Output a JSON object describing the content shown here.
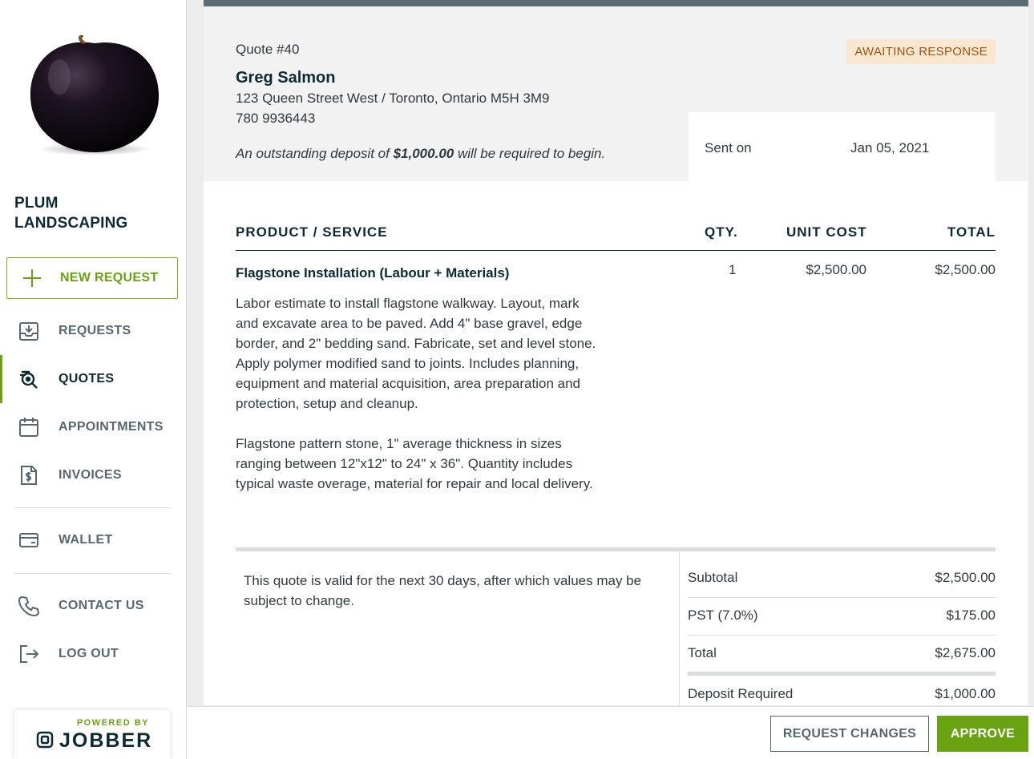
{
  "company": {
    "name": "PLUM LANDSCAPING"
  },
  "sidebar": {
    "new_request": "NEW REQUEST",
    "items": [
      {
        "label": "REQUESTS",
        "icon": "inbox-download-icon"
      },
      {
        "label": "QUOTES",
        "icon": "quote-search-icon"
      },
      {
        "label": "APPOINTMENTS",
        "icon": "calendar-icon"
      },
      {
        "label": "INVOICES",
        "icon": "invoice-dollar-icon"
      },
      {
        "label": "WALLET",
        "icon": "wallet-card-icon"
      },
      {
        "label": "CONTACT US",
        "icon": "phone-icon"
      },
      {
        "label": "LOG OUT",
        "icon": "logout-icon"
      }
    ],
    "powered_by": "POWERED BY",
    "brand": "JOBBER"
  },
  "quote": {
    "number": "Quote #40",
    "status": "AWAITING RESPONSE",
    "client_name": "Greg Salmon",
    "address": "123 Queen Street West / Toronto, Ontario M5H 3M9",
    "phone": "780 9936443",
    "deposit_prefix": "An outstanding deposit of ",
    "deposit_amount": "$1,000.00",
    "deposit_suffix": " will be required to begin.",
    "sent_label": "Sent on",
    "sent_date": "Jan 05, 2021"
  },
  "table": {
    "headers": {
      "product": "PRODUCT / SERVICE",
      "qty": "QTY.",
      "unit_cost": "UNIT COST",
      "total": "TOTAL"
    },
    "items": [
      {
        "name": "Flagstone Installation (Labour + Materials)",
        "qty": "1",
        "unit_cost": "$2,500.00",
        "total": "$2,500.00",
        "description": "Labor estimate to install flagstone walkway. Layout, mark and excavate area to be paved. Add 4\" base gravel, edge border, and 2\" bedding sand. Fabricate, set and level stone. Apply polymer modified sand to joints. Includes planning, equipment and material acquisition, area preparation and protection, setup and cleanup.\n\nFlagstone pattern stone, 1\" average thickness in sizes ranging between 12\"x12\" to 24\" x 36\". Quantity includes typical waste overage, material for repair and local delivery."
      }
    ]
  },
  "summary": {
    "validity": "This quote is valid for the next 30 days, after which values may be subject to change.",
    "subtotal_label": "Subtotal",
    "subtotal": "$2,500.00",
    "tax_label": "PST (7.0%)",
    "tax": "$175.00",
    "total_label": "Total",
    "total": "$2,675.00",
    "deposit_label": "Deposit Required",
    "deposit": "$1,000.00"
  },
  "footer": {
    "request_changes": "REQUEST CHANGES",
    "approve": "APPROVE"
  },
  "colors": {
    "accent": "#6aa312",
    "dark": "#0b2a33",
    "badge_bg": "#fbe6cf",
    "badge_text": "#9c5510"
  }
}
